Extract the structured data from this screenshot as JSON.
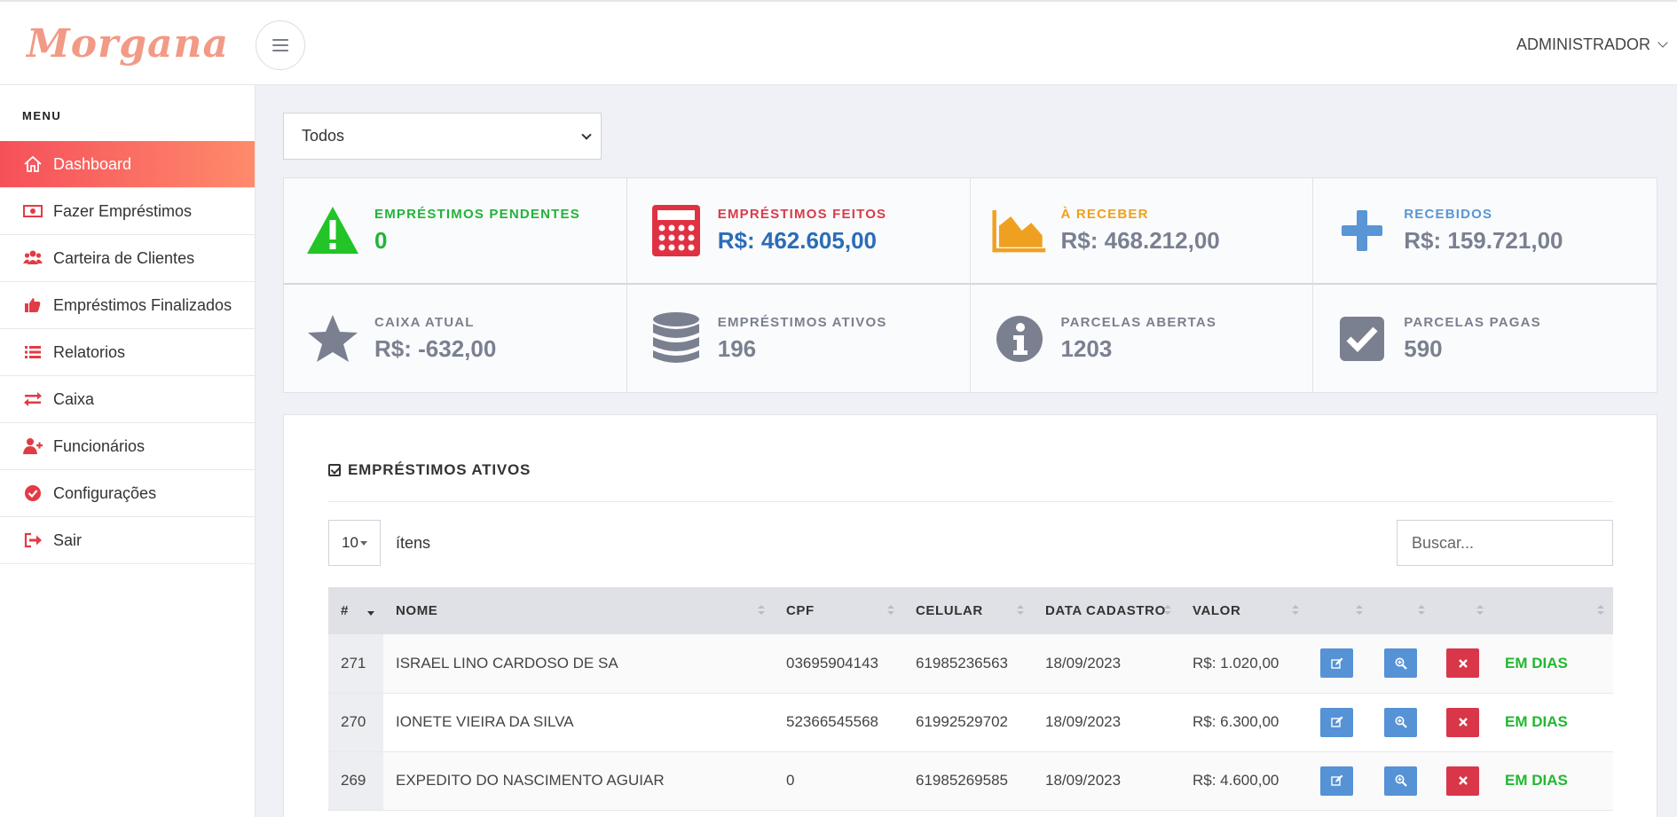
{
  "header": {
    "logo": "Morgana",
    "user_menu": "ADMINISTRADOR"
  },
  "sidebar": {
    "menu_title": "MENU",
    "items": [
      {
        "label": "Dashboard",
        "icon": "home-icon",
        "active": true
      },
      {
        "label": "Fazer Empréstimos",
        "icon": "money-bill-icon"
      },
      {
        "label": "Carteira de Clientes",
        "icon": "users-icon"
      },
      {
        "label": "Empréstimos Finalizados",
        "icon": "thumbs-up-icon"
      },
      {
        "label": "Relatorios",
        "icon": "list-icon"
      },
      {
        "label": "Caixa",
        "icon": "exchange-icon"
      },
      {
        "label": "Funcionários",
        "icon": "user-plus-icon"
      },
      {
        "label": "Configurações",
        "icon": "check-circle-icon"
      },
      {
        "label": "Sair",
        "icon": "sign-out-icon"
      }
    ]
  },
  "filter": {
    "selected": "Todos"
  },
  "stats": [
    {
      "label": "EMPRÉSTIMOS PENDENTES",
      "value": "0",
      "icon": "warning-icon",
      "color": "#22b33a"
    },
    {
      "label": "EMPRÉSTIMOS FEITOS",
      "value": "R$: 462.605,00",
      "icon": "calculator-icon",
      "color": "#d93b4a"
    },
    {
      "label": "À RECEBER",
      "value": "R$: 468.212,00",
      "icon": "area-chart-icon",
      "color": "#f0a020"
    },
    {
      "label": "RECEBIDOS",
      "value": "R$: 159.721,00",
      "icon": "plus-icon",
      "color": "#5a95d5"
    },
    {
      "label": "CAIXA ATUAL",
      "value": "R$: -632,00",
      "icon": "star-icon",
      "color": "#7a8090"
    },
    {
      "label": "EMPRÉSTIMOS ATIVOS",
      "value": "196",
      "icon": "database-icon",
      "color": "#7a8090"
    },
    {
      "label": "PARCELAS ABERTAS",
      "value": "1203",
      "icon": "info-icon",
      "color": "#7a8090"
    },
    {
      "label": "PARCELAS PAGAS",
      "value": "590",
      "icon": "check-square-icon",
      "color": "#7a8090"
    }
  ],
  "panel": {
    "title": "EMPRÉSTIMOS ATIVOS",
    "per_page": "10",
    "per_page_label": "ítens",
    "search_placeholder": "Buscar..."
  },
  "table": {
    "columns": [
      "#",
      "NOME",
      "CPF",
      "CELULAR",
      "DATA CADASTRO",
      "VALOR",
      "",
      "",
      "",
      ""
    ],
    "rows": [
      {
        "id": "271",
        "nome": "ISRAEL LINO CARDOSO DE SA",
        "cpf": "03695904143",
        "celular": "61985236563",
        "data": "18/09/2023",
        "valor": "R$: 1.020,00",
        "status": "EM DIAS"
      },
      {
        "id": "270",
        "nome": "IONETE VIEIRA DA SILVA",
        "cpf": "52366545568",
        "celular": "61992529702",
        "data": "18/09/2023",
        "valor": "R$: 6.300,00",
        "status": "EM DIAS"
      },
      {
        "id": "269",
        "nome": "EXPEDITO DO NASCIMENTO AGUIAR",
        "cpf": "0",
        "celular": "61985269585",
        "data": "18/09/2023",
        "valor": "R$: 4.600,00",
        "status": "EM DIAS"
      }
    ]
  }
}
